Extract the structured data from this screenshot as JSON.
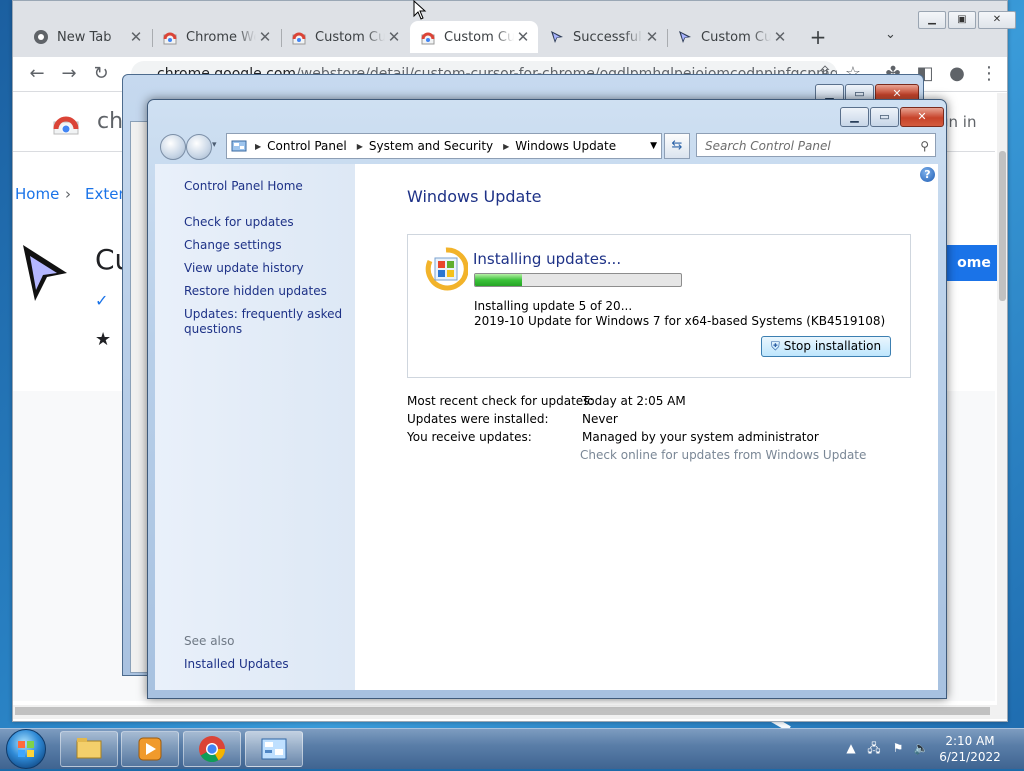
{
  "browser": {
    "tabs": [
      {
        "title": "New Tab",
        "icon": "chrome-icon"
      },
      {
        "title": "Chrome Web Store",
        "icon": "chrome-webstore-icon"
      },
      {
        "title": "Custom Cursor for Chrome",
        "icon": "chrome-webstore-icon"
      },
      {
        "title": "Custom Cursor for Chrome",
        "icon": "chrome-webstore-icon",
        "active": true
      },
      {
        "title": "Successful installation",
        "icon": "cursor-icon"
      },
      {
        "title": "Custom Cursor",
        "icon": "cursor-icon"
      }
    ],
    "new_tab_label": "+",
    "url_host": "chrome.google.com",
    "url_path": "/webstore/detail/custom-cursor-for-chrome/ogdlpmhglpejoiomcodnpjnfgcpmgale",
    "page": {
      "brand_partial": "ch",
      "sign_in": "gn in",
      "breadcrumb_home": "Home",
      "breadcrumb_ext": "Exten",
      "ext_name_partial": "Cu",
      "install_partial": "ome"
    }
  },
  "window": {
    "address": {
      "segments": [
        "Control Panel",
        "System and Security",
        "Windows Update"
      ],
      "search_placeholder": "Search Control Panel"
    },
    "sidebar": {
      "home": "Control Panel Home",
      "links": [
        "Check for updates",
        "Change settings",
        "View update history",
        "Restore hidden updates",
        "Updates: frequently asked",
        "questions"
      ],
      "see_also": "See also",
      "installed_updates": "Installed Updates"
    },
    "title": "Windows Update",
    "status": {
      "heading": "Installing updates...",
      "progress": 0.23,
      "line1": "Installing update 5 of 20...",
      "line2": "2019-10 Update for Windows 7 for x64-based Systems (KB4519108)",
      "stop_button": "Stop installation"
    },
    "info": [
      {
        "label": "Most recent check for updates:",
        "value": "Today at 2:05 AM"
      },
      {
        "label": "Updates were installed:",
        "value": "Never"
      },
      {
        "label": "You receive updates:",
        "value": "Managed by your system administrator"
      }
    ],
    "online_link": "Check online for updates from Windows Update"
  },
  "taskbar": {
    "time": "2:10 AM",
    "date": "6/21/2022"
  },
  "colors": {
    "link": "#1e3287",
    "progress": "#3cc23a",
    "install_button": "#1a73e8"
  }
}
